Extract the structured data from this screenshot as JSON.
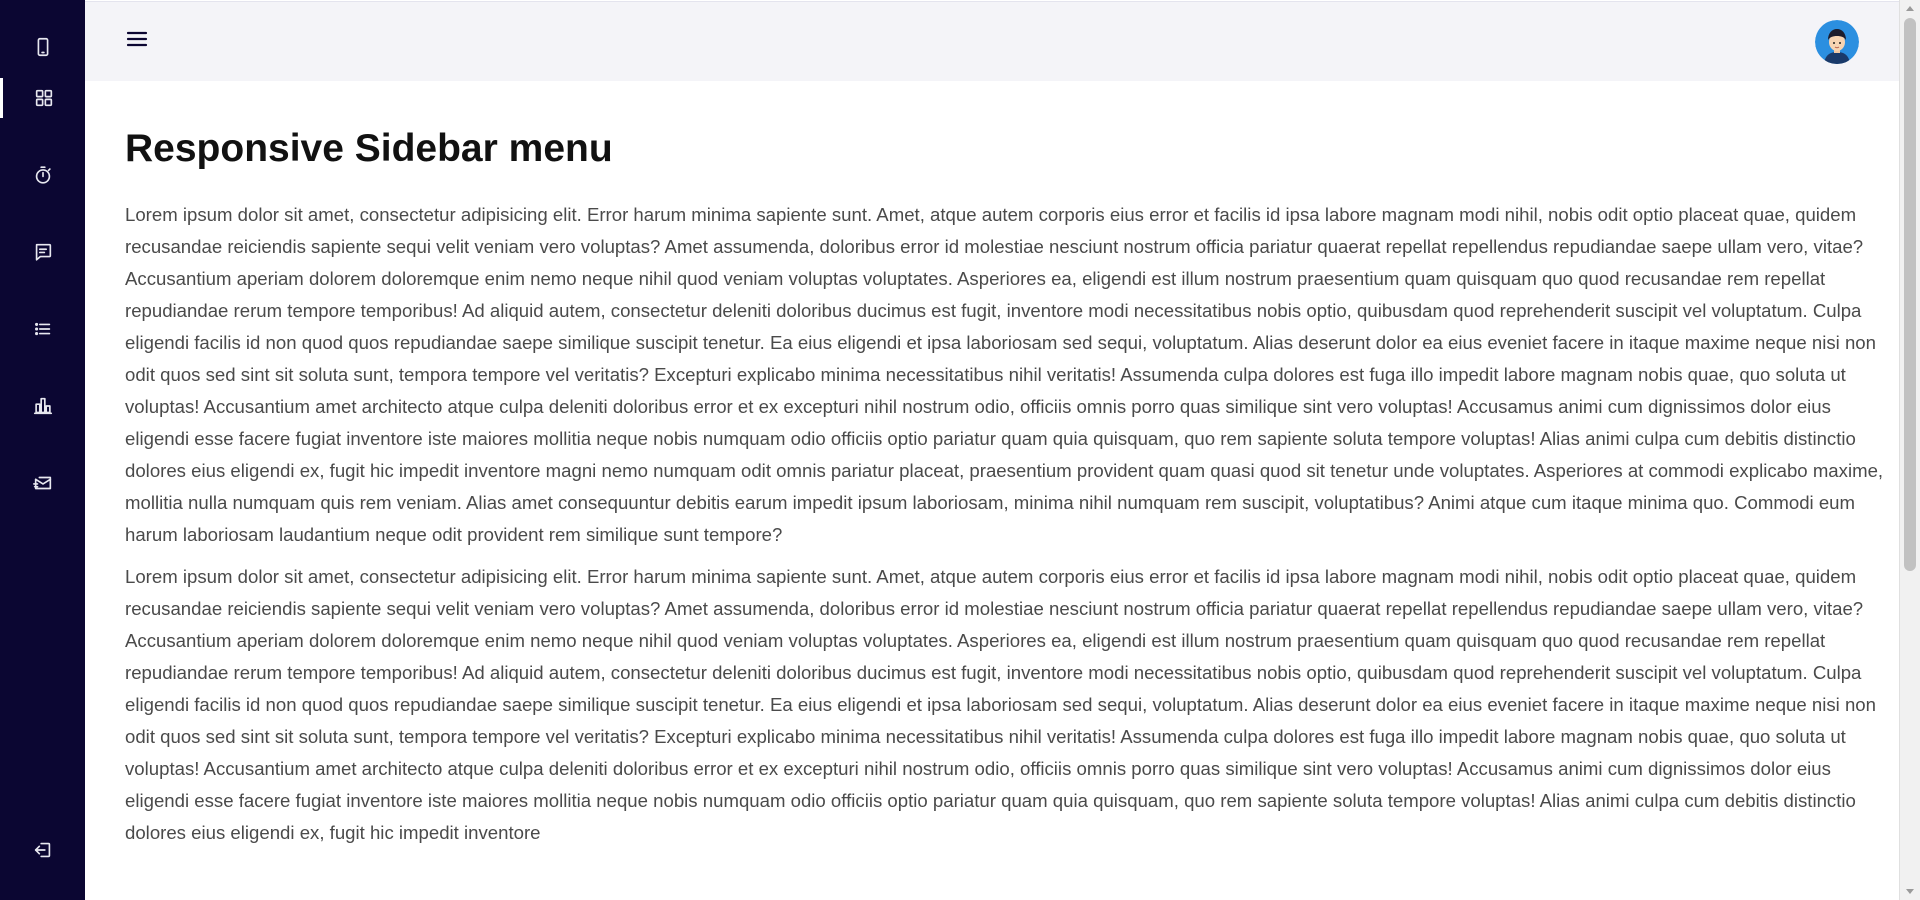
{
  "sidebar": {
    "items": [
      {
        "icon": "phone-icon"
      },
      {
        "icon": "grid-icon",
        "active": true
      },
      {
        "icon": "timer-icon"
      },
      {
        "icon": "message-icon"
      },
      {
        "icon": "list-icon"
      },
      {
        "icon": "bar-chart-icon"
      },
      {
        "icon": "mail-send-icon"
      }
    ],
    "logout": {
      "icon": "logout-icon"
    }
  },
  "header": {
    "menu_icon": "menu-icon",
    "avatar": "user-avatar"
  },
  "main": {
    "title": "Responsive Sidebar menu",
    "paragraphs": [
      "Lorem ipsum dolor sit amet, consectetur adipisicing elit. Error harum minima sapiente sunt. Amet, atque autem corporis eius error et facilis id ipsa labore magnam modi nihil, nobis odit optio placeat quae, quidem recusandae reiciendis sapiente sequi velit veniam vero voluptas? Amet assumenda, doloribus error id molestiae nesciunt nostrum officia pariatur quaerat repellat repellendus repudiandae saepe ullam vero, vitae? Accusantium aperiam dolorem doloremque enim nemo neque nihil quod veniam voluptas voluptates. Asperiores ea, eligendi est illum nostrum praesentium quam quisquam quo quod recusandae rem repellat repudiandae rerum tempore temporibus! Ad aliquid autem, consectetur deleniti doloribus ducimus est fugit, inventore modi necessitatibus nobis optio, quibusdam quod reprehenderit suscipit vel voluptatum. Culpa eligendi facilis id non quod quos repudiandae saepe similique suscipit tenetur. Ea eius eligendi et ipsa laboriosam sed sequi, voluptatum. Alias deserunt dolor ea eius eveniet facere in itaque maxime neque nisi non odit quos sed sint sit soluta sunt, tempora tempore vel veritatis? Excepturi explicabo minima necessitatibus nihil veritatis! Assumenda culpa dolores est fuga illo impedit labore magnam nobis quae, quo soluta ut voluptas! Accusantium amet architecto atque culpa deleniti doloribus error et ex excepturi nihil nostrum odio, officiis omnis porro quas similique sint vero voluptas! Accusamus animi cum dignissimos dolor eius eligendi esse facere fugiat inventore iste maiores mollitia neque nobis numquam odio officiis optio pariatur quam quia quisquam, quo rem sapiente soluta tempore voluptas! Alias animi culpa cum debitis distinctio dolores eius eligendi ex, fugit hic impedit inventore magni nemo numquam odit omnis pariatur placeat, praesentium provident quam quasi quod sit tenetur unde voluptates. Asperiores at commodi explicabo maxime, mollitia nulla numquam quis rem veniam. Alias amet consequuntur debitis earum impedit ipsum laboriosam, minima nihil numquam rem suscipit, voluptatibus? Animi atque cum itaque minima quo. Commodi eum harum laboriosam laudantium neque odit provident rem similique sunt tempore?",
      "Lorem ipsum dolor sit amet, consectetur adipisicing elit. Error harum minima sapiente sunt. Amet, atque autem corporis eius error et facilis id ipsa labore magnam modi nihil, nobis odit optio placeat quae, quidem recusandae reiciendis sapiente sequi velit veniam vero voluptas? Amet assumenda, doloribus error id molestiae nesciunt nostrum officia pariatur quaerat repellat repellendus repudiandae saepe ullam vero, vitae? Accusantium aperiam dolorem doloremque enim nemo neque nihil quod veniam voluptas voluptates. Asperiores ea, eligendi est illum nostrum praesentium quam quisquam quo quod recusandae rem repellat repudiandae rerum tempore temporibus! Ad aliquid autem, consectetur deleniti doloribus ducimus est fugit, inventore modi necessitatibus nobis optio, quibusdam quod reprehenderit suscipit vel voluptatum. Culpa eligendi facilis id non quod quos repudiandae saepe similique suscipit tenetur. Ea eius eligendi et ipsa laboriosam sed sequi, voluptatum. Alias deserunt dolor ea eius eveniet facere in itaque maxime neque nisi non odit quos sed sint sit soluta sunt, tempora tempore vel veritatis? Excepturi explicabo minima necessitatibus nihil veritatis! Assumenda culpa dolores est fuga illo impedit labore magnam nobis quae, quo soluta ut voluptas! Accusantium amet architecto atque culpa deleniti doloribus error et ex excepturi nihil nostrum odio, officiis omnis porro quas similique sint vero voluptas! Accusamus animi cum dignissimos dolor eius eligendi esse facere fugiat inventore iste maiores mollitia neque nobis numquam odio officiis optio pariatur quam quia quisquam, quo rem sapiente soluta tempore voluptas! Alias animi culpa cum debitis distinctio dolores eius eligendi ex, fugit hic impedit inventore"
    ]
  },
  "colors": {
    "sidebar_bg": "#0b0632",
    "header_bg": "#f4f4f8",
    "text": "#4a4a4a",
    "title": "#111111"
  }
}
